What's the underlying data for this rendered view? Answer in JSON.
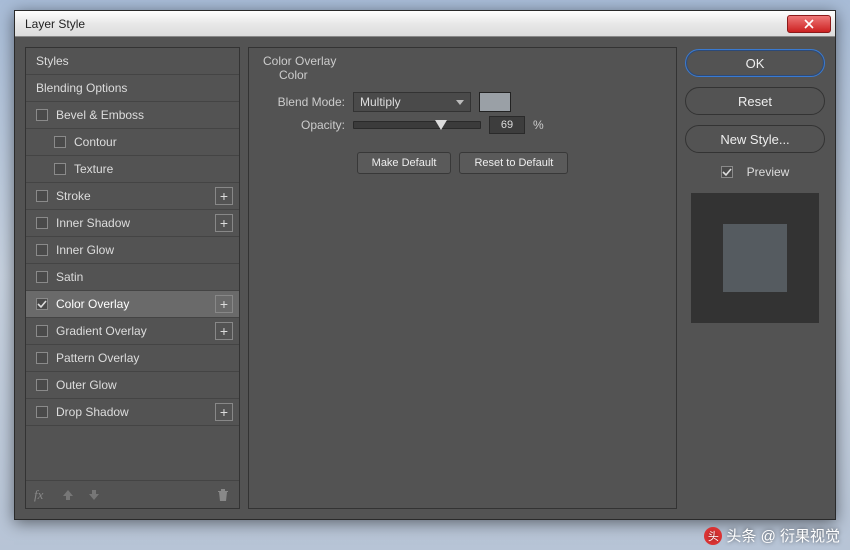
{
  "window": {
    "title": "Layer Style"
  },
  "styles_panel": {
    "header1": "Styles",
    "header2": "Blending Options",
    "items": [
      {
        "label": "Bevel & Emboss",
        "checked": false,
        "expand": false,
        "indent": 0
      },
      {
        "label": "Contour",
        "checked": false,
        "expand": false,
        "indent": 1
      },
      {
        "label": "Texture",
        "checked": false,
        "expand": false,
        "indent": 1
      },
      {
        "label": "Stroke",
        "checked": false,
        "expand": true,
        "indent": 0
      },
      {
        "label": "Inner Shadow",
        "checked": false,
        "expand": true,
        "indent": 0
      },
      {
        "label": "Inner Glow",
        "checked": false,
        "expand": false,
        "indent": 0
      },
      {
        "label": "Satin",
        "checked": false,
        "expand": false,
        "indent": 0
      },
      {
        "label": "Color Overlay",
        "checked": true,
        "expand": true,
        "indent": 0,
        "selected": true
      },
      {
        "label": "Gradient Overlay",
        "checked": false,
        "expand": true,
        "indent": 0
      },
      {
        "label": "Pattern Overlay",
        "checked": false,
        "expand": false,
        "indent": 0
      },
      {
        "label": "Outer Glow",
        "checked": false,
        "expand": false,
        "indent": 0
      },
      {
        "label": "Drop Shadow",
        "checked": false,
        "expand": true,
        "indent": 0
      }
    ],
    "fx_label": "fx"
  },
  "center": {
    "title": "Color Overlay",
    "subtitle": "Color",
    "blend_label": "Blend Mode:",
    "blend_value": "Multiply",
    "swatch_color": "#9aa0a6",
    "opacity_label": "Opacity:",
    "opacity_value": "69",
    "opacity_unit": "%",
    "make_default": "Make Default",
    "reset_default": "Reset to Default"
  },
  "right": {
    "ok": "OK",
    "reset": "Reset",
    "new_style": "New Style...",
    "preview_label": "Preview",
    "preview_checked": true
  },
  "watermark": "头条 @ 衍果视觉"
}
